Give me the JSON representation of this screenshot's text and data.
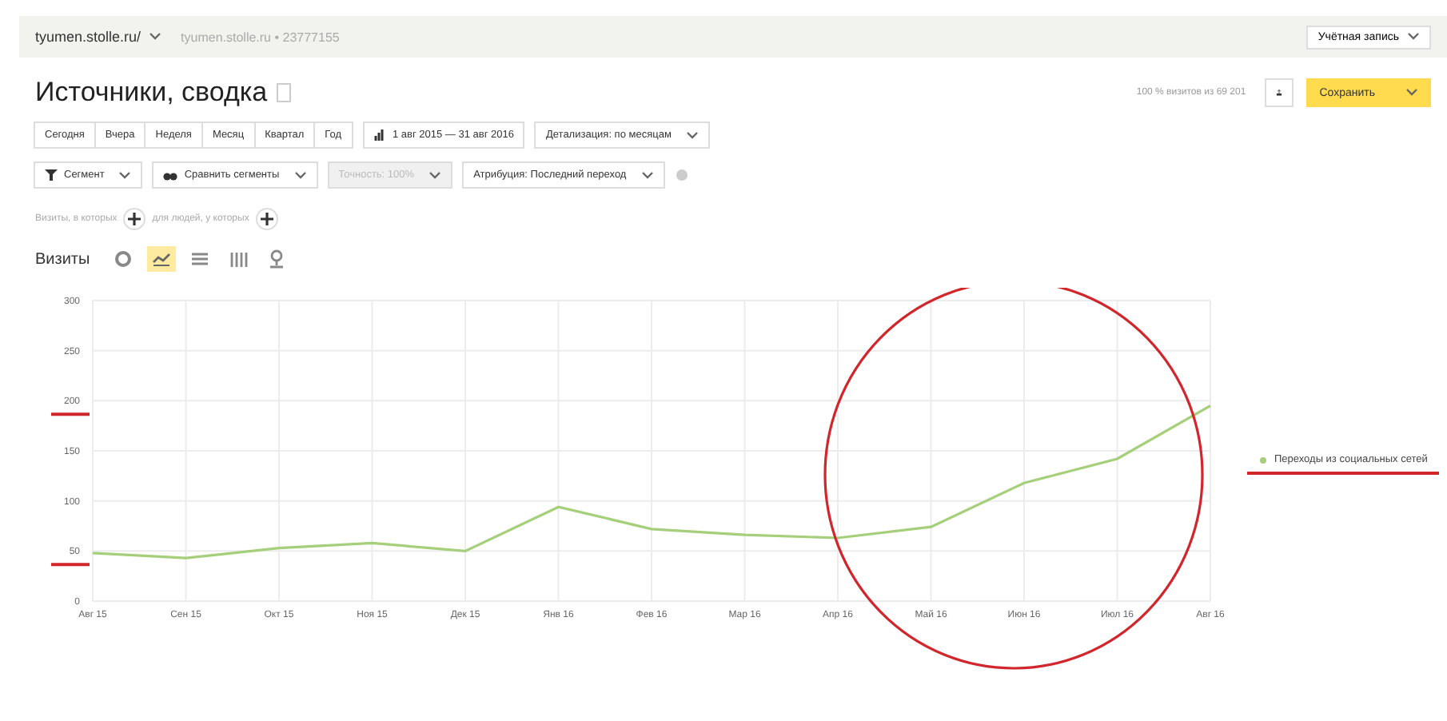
{
  "header": {
    "site": "tyumen.stolle.ru/",
    "counter": "tyumen.stolle.ru • 23777155",
    "account": "Учётная запись"
  },
  "title": "Источники, сводка",
  "sample": "100 % визитов из 69 201",
  "save": "Сохранить",
  "periods": [
    {
      "label": "Сегодня",
      "selected": false
    },
    {
      "label": "Вчера",
      "selected": false
    },
    {
      "label": "Неделя",
      "selected": false
    },
    {
      "label": "Месяц",
      "selected": false
    },
    {
      "label": "Квартал",
      "selected": false
    },
    {
      "label": "Год",
      "selected": false
    }
  ],
  "date_range": "1 авг 2015 — 31 авг 2016",
  "detail": "Детализация: по месяцам",
  "filters": [
    {
      "label": "Сегмент",
      "kind": "segment",
      "disabled": false
    },
    {
      "label": "Сравнить сегменты",
      "kind": "compare",
      "disabled": false
    },
    {
      "label": "Точность: 100%",
      "kind": "plain",
      "disabled": true
    },
    {
      "label": "Атрибуция: Последний переход",
      "kind": "plain",
      "disabled": false
    }
  ],
  "conditions": {
    "visits": "Визиты, в которых",
    "people": "для людей, у которых"
  },
  "metric": "Визиты",
  "chart_types": [
    {
      "kind": "pie",
      "selected": false
    },
    {
      "kind": "line",
      "selected": true
    },
    {
      "kind": "area",
      "selected": false
    },
    {
      "kind": "bar",
      "selected": false
    },
    {
      "kind": "map",
      "selected": false
    }
  ],
  "chart_data": {
    "type": "line",
    "grid": true,
    "categories": [
      "Авг 15",
      "Сен 15",
      "Окт 15",
      "Ноя 15",
      "Дек 15",
      "Янв 16",
      "Фев 16",
      "Мар 16",
      "Апр 16",
      "Май 16",
      "Июн 16",
      "Июл 16",
      "Авг 16"
    ],
    "ylim": [
      0,
      300
    ],
    "yticks": [
      0,
      50,
      100,
      150,
      200,
      250,
      300
    ],
    "series": [
      {
        "name": "Переходы из социальных сетей",
        "color": "#a5cf7a",
        "values": [
          48,
          43,
          53,
          58,
          50,
          94,
          72,
          66,
          63,
          74,
          118,
          142,
          195
        ]
      }
    ]
  }
}
